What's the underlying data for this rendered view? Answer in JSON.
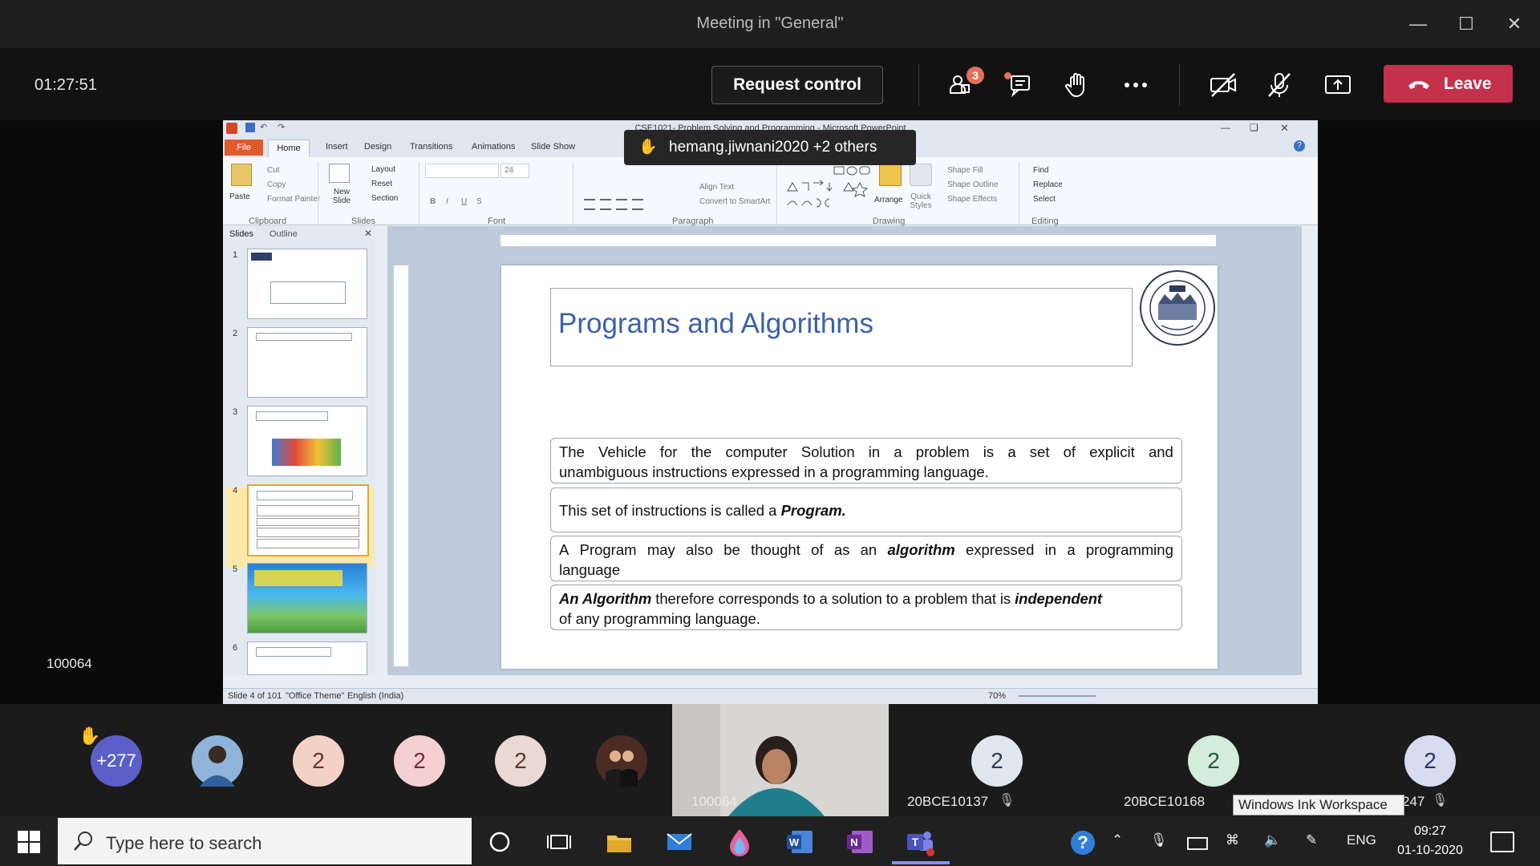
{
  "window": {
    "title": "Meeting in \"General\""
  },
  "meeting": {
    "timer": "01:27:51",
    "request_control": "Request control",
    "participants_badge": "3",
    "leave": "Leave",
    "presenter_id": "100064",
    "raise_hand_toast": "hemang.jiwnani2020 +2 others"
  },
  "powerpoint": {
    "title": "CSE1021- Problem Solving and Programming  -  Microsoft PowerPoint",
    "tabs": [
      "File",
      "Home",
      "Insert",
      "Design",
      "Transitions",
      "Animations",
      "Slide Show"
    ],
    "ribbon": {
      "clipboard": {
        "paste": "Paste",
        "cut": "Cut",
        "copy": "Copy",
        "format_painter": "Format Painter",
        "label": "Clipboard"
      },
      "slides": {
        "new_slide": "New Slide",
        "layout": "Layout",
        "reset": "Reset",
        "section": "Section",
        "label": "Slides"
      },
      "font": {
        "label": "Font",
        "size": "24"
      },
      "paragraph": {
        "align_text": "Align Text",
        "convert": "Convert to SmartArt",
        "label": "Paragraph"
      },
      "drawing": {
        "arrange": "Arrange",
        "quick_styles": "Quick Styles",
        "shape_fill": "Shape Fill",
        "shape_outline": "Shape Outline",
        "shape_effects": "Shape Effects",
        "label": "Drawing"
      },
      "editing": {
        "find": "Find",
        "replace": "Replace",
        "select": "Select",
        "label": "Editing"
      }
    },
    "pane_tabs": {
      "slides": "Slides",
      "outline": "Outline"
    },
    "thumbs": [
      "1",
      "2",
      "3",
      "4",
      "5",
      "6"
    ],
    "slide": {
      "title": "Programs and Algorithms",
      "b1_line1": [
        "The",
        "Vehicle",
        "for",
        "the",
        "computer",
        "Solution",
        "in",
        "a",
        "problem",
        "is",
        "a",
        "set",
        "of",
        "explicit",
        "and"
      ],
      "b1_line2": "unambiguous instructions expressed in a programming language.",
      "b2_pre": "This set of instructions is called a ",
      "b2_em": "Program.",
      "b3_line1": [
        "A",
        "Program",
        "may",
        "also",
        "be",
        "thought",
        "of",
        "as",
        "an",
        "algorithm",
        "expressed",
        "in",
        "a",
        "programming"
      ],
      "b3_line2": "language",
      "b4_em1": "An Algorithm",
      "b4_mid": " therefore corresponds to a solution to a problem that is ",
      "b4_em2": "independent",
      "b4_line2": "of any programming language."
    },
    "status": {
      "slide": "Slide 4 of 101",
      "theme": "\"Office Theme\"",
      "language": "English (India)",
      "zoom": "70%"
    }
  },
  "participants": [
    {
      "label": "+277",
      "color": "#5b5fc7"
    },
    {
      "label": "2",
      "color": "#f3d2c6"
    },
    {
      "label": "2",
      "color": "#f5d0d3"
    },
    {
      "label": "2",
      "color": "#ead8d2"
    },
    {
      "label": "2",
      "name": "20BCE10137",
      "color": "#dfe6ee"
    },
    {
      "label": "2",
      "name": "20BCE10168",
      "color": "#d4ecdc"
    },
    {
      "label": "2",
      "name": "247",
      "color": "#d8dcf0"
    }
  ],
  "video_tile_name": "100064",
  "ink_tooltip": "Windows Ink Workspace",
  "taskbar": {
    "search_placeholder": "Type here to search",
    "lang": "ENG",
    "time": "09:27",
    "date": "01-10-2020"
  }
}
